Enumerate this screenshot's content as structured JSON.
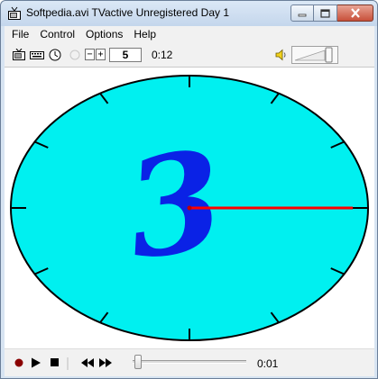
{
  "window": {
    "title": "Softpedia.avi TVactive Unregistered  Day 1"
  },
  "menu": [
    {
      "label": "File"
    },
    {
      "label": "Control"
    },
    {
      "label": "Options"
    },
    {
      "label": "Help"
    }
  ],
  "toolbar": {
    "icons": [
      "tv-icon",
      "keyboard-icon",
      "clock-icon"
    ],
    "decrement_label": "−",
    "increment_label": "+",
    "count_value": "5",
    "elapsed_time": "0:12",
    "volume_icon": "speaker-icon"
  },
  "display": {
    "clock_face_color": "#00f0f0",
    "hand_color": "#ff0000",
    "numeral_color": "#0a22e6",
    "numeral": "3",
    "hand_points_to_hour": 3
  },
  "controls": {
    "icons": [
      "record-icon",
      "play-icon",
      "stop-icon",
      "rewind-icon",
      "fast-forward-icon"
    ],
    "record_color": "#8a0000",
    "seek_position": 0.05,
    "current_time": "0:01"
  }
}
